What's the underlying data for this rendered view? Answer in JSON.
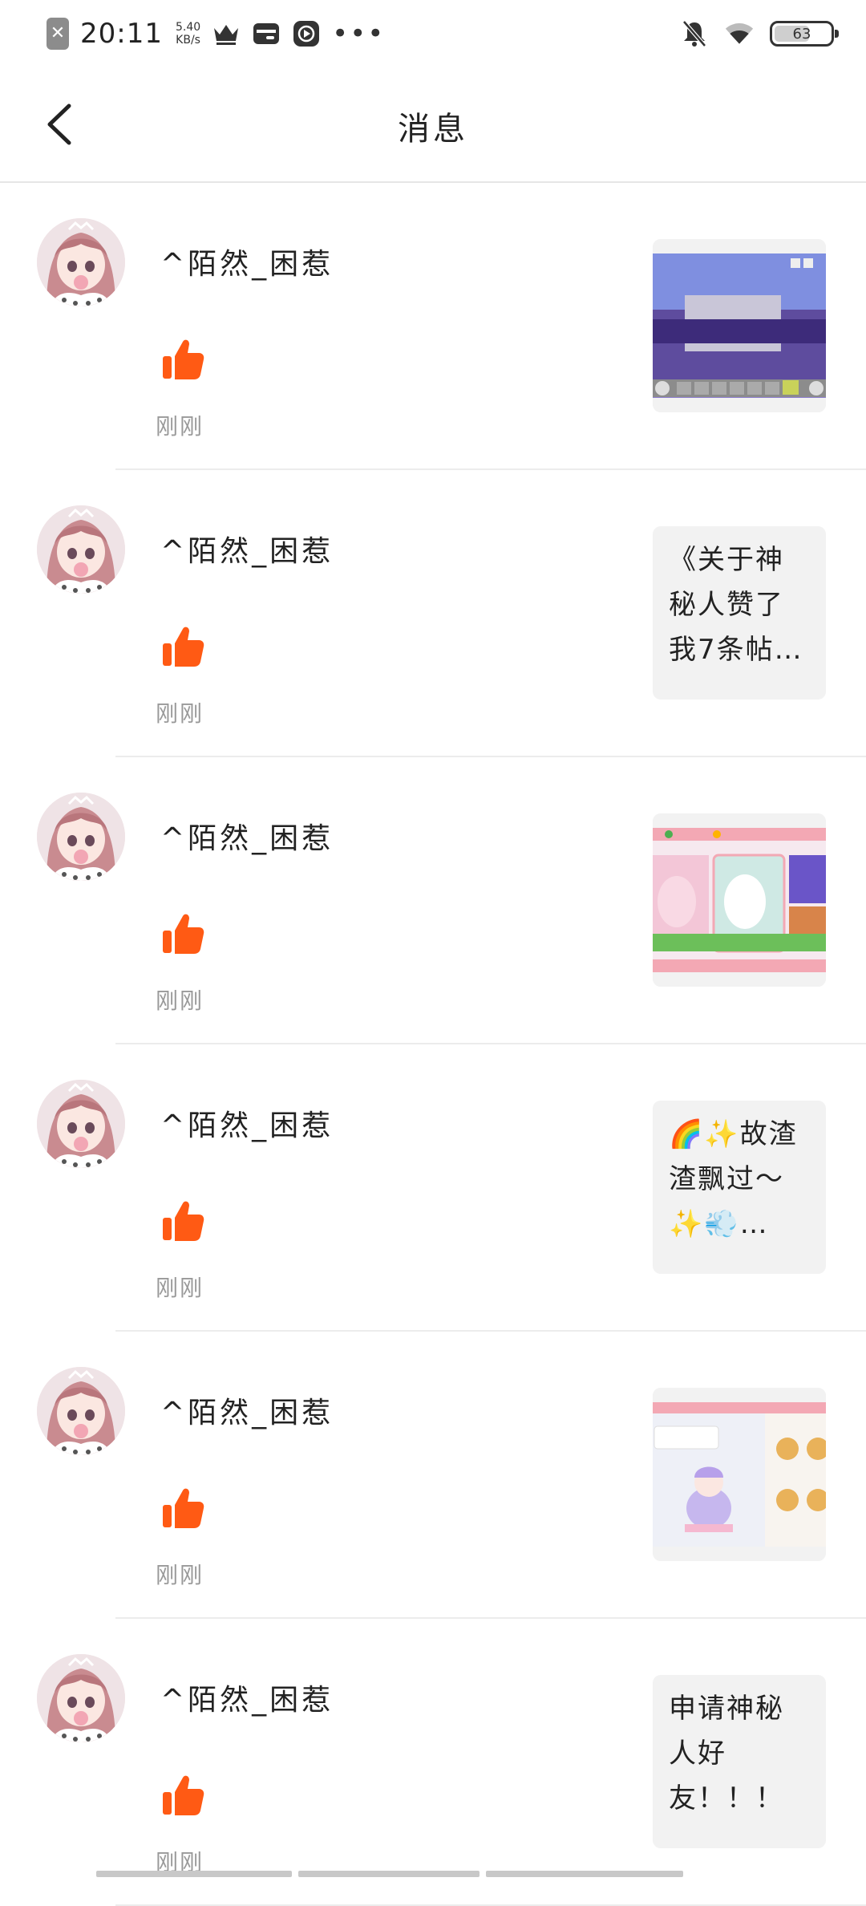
{
  "status_bar": {
    "time": "20:11",
    "speed_value": "5.40",
    "speed_unit": "KB/s",
    "battery": "63",
    "battery_level": 0.63,
    "icons": [
      "close-badge-icon",
      "crown-icon",
      "wallet-icon",
      "play-icon",
      "more-dots-icon",
      "mute-bell-icon",
      "wifi-icon",
      "battery-icon"
    ],
    "dots": "•••"
  },
  "header": {
    "title": "消息",
    "back_icon": "chevron-left-icon"
  },
  "colors": {
    "like": "#FF5A14",
    "muted_text": "#999999",
    "preview_bg": "#F2F2F2"
  },
  "messages": [
    {
      "username": "^陌然_困惹",
      "time": "刚刚",
      "icon": "thumbs-up-icon",
      "preview": {
        "kind": "image",
        "description": "game-screenshot-233-park"
      }
    },
    {
      "username": "^陌然_困惹",
      "time": "刚刚",
      "icon": "thumbs-up-icon",
      "preview": {
        "kind": "text",
        "text": "《关于神秘人赞了我7条帖…"
      }
    },
    {
      "username": "^陌然_困惹",
      "time": "刚刚",
      "icon": "thumbs-up-icon",
      "preview": {
        "kind": "image",
        "description": "game-lobby-screenshot"
      }
    },
    {
      "username": "^陌然_困惹",
      "time": "刚刚",
      "icon": "thumbs-up-icon",
      "preview": {
        "kind": "text",
        "text": "🌈✨故渣渣飘过～✨💨…"
      }
    },
    {
      "username": "^陌然_困惹",
      "time": "刚刚",
      "icon": "thumbs-up-icon",
      "preview": {
        "kind": "image",
        "description": "game-character-screenshot"
      }
    },
    {
      "username": "^陌然_困惹",
      "time": "刚刚",
      "icon": "thumbs-up-icon",
      "preview": {
        "kind": "text",
        "text": "申请神秘人好友！！！"
      }
    }
  ]
}
